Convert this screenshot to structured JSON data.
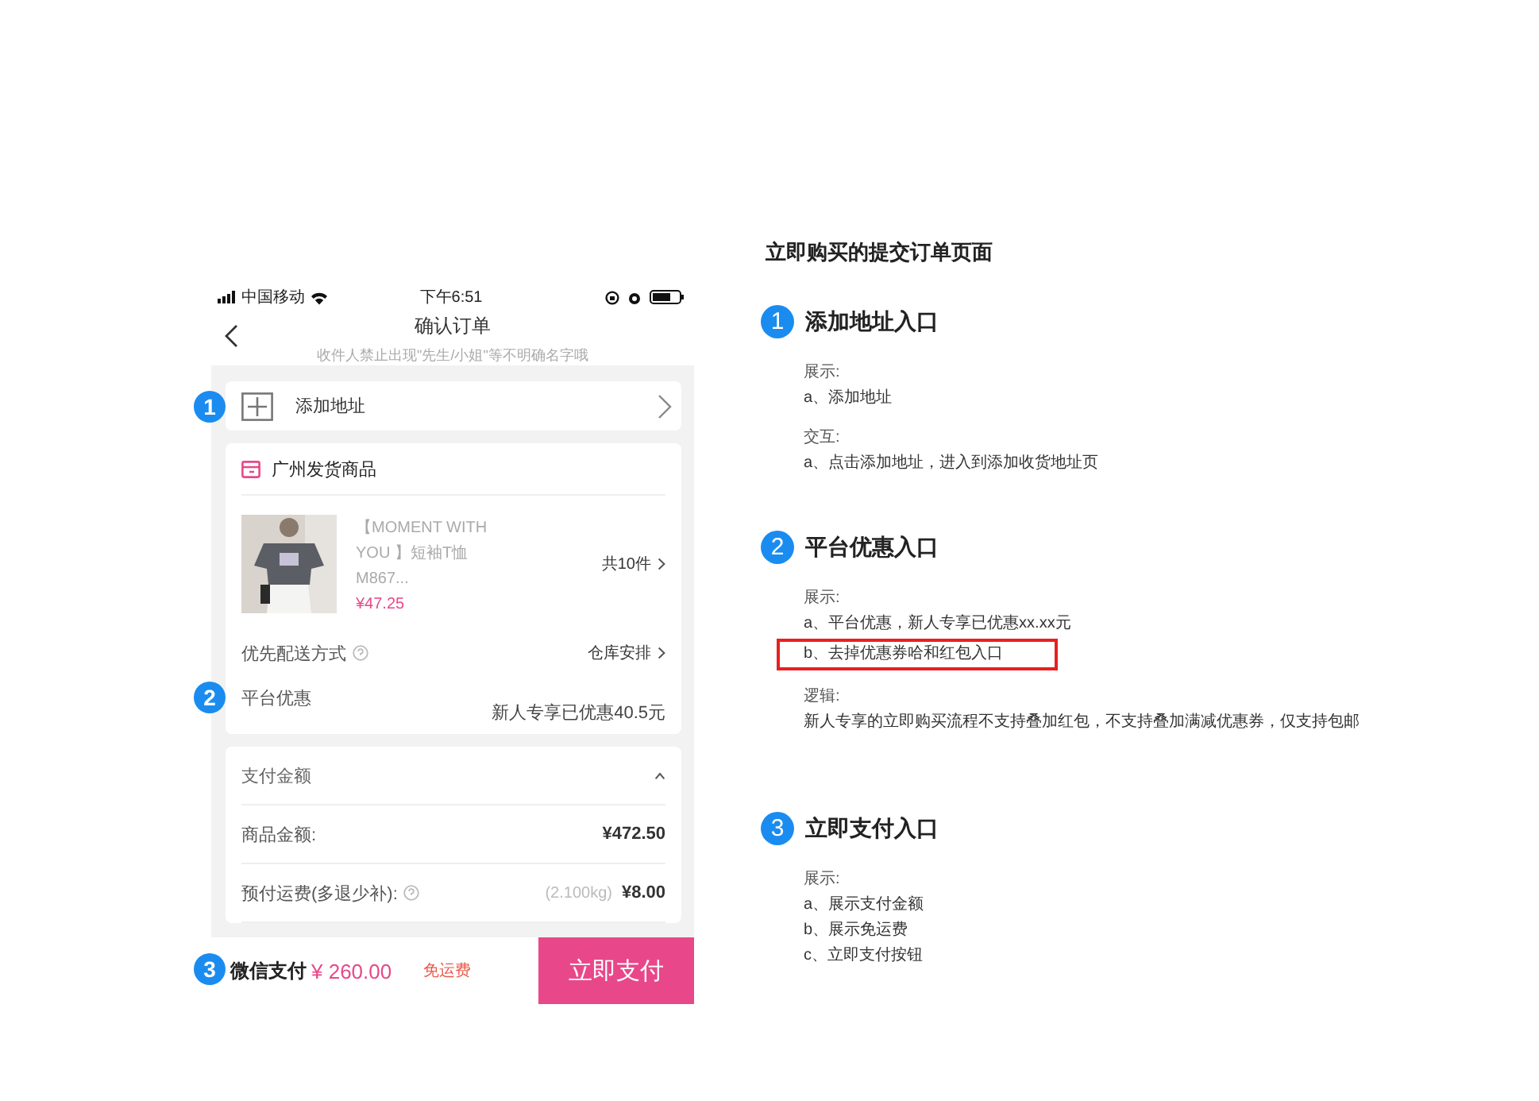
{
  "phone": {
    "status_bar": {
      "carrier": "中国移动",
      "time": "下午6:51"
    },
    "nav": {
      "title": "确认订单",
      "subtitle": "收件人禁止出现\"先生/小姐\"等不明确名字哦"
    },
    "address": {
      "marker": "1",
      "label": "添加地址"
    },
    "goods": {
      "store": "广州发货商品",
      "product": {
        "kind": "picture",
        "name": "【MOMENT WITH YOU 】短袖T恤  M867...",
        "price": "¥47.25",
        "count": "共10件"
      },
      "delivery": {
        "label": "优先配送方式",
        "value": "仓库安排"
      },
      "platform": {
        "marker": "2",
        "label": "平台优惠",
        "value": "新人专享已优惠40.5元"
      }
    },
    "payment": {
      "title": "支付金额",
      "expanded": true,
      "rows": [
        {
          "label": "商品金额:",
          "help": false,
          "value": "¥472.50"
        },
        {
          "label": "预付运费(多退少补):",
          "help": true,
          "note": "(2.100kg)",
          "value": "¥8.00"
        }
      ]
    },
    "bottom_bar": {
      "marker": "3",
      "method": "微信支付",
      "amount": "¥ 260.00",
      "shipping": "免运费",
      "button": "立即支付"
    }
  },
  "notes": {
    "title": "立即购买的提交订单页面",
    "sections": [
      {
        "number": "1",
        "title": "添加地址入口",
        "blocks": [
          {
            "heading": "展示:",
            "lines": [
              {
                "text": "a、添加地址",
                "highlighted": false
              }
            ]
          },
          {
            "heading": "交互:",
            "lines": [
              {
                "text": "a、点击添加地址，进入到添加收货地址页",
                "highlighted": false
              }
            ]
          }
        ]
      },
      {
        "number": "2",
        "title": "平台优惠入口",
        "blocks": [
          {
            "heading": "展示:",
            "lines": [
              {
                "text": "a、平台优惠，新人专享已优惠xx.xx元",
                "highlighted": false
              },
              {
                "text": "b、去掉优惠券哈和红包入口",
                "highlighted": true
              }
            ]
          },
          {
            "heading": "逻辑:",
            "lines": [
              {
                "text": "新人专享的立即购买流程不支持叠加红包，不支持叠加满减优惠券，仅支持包邮",
                "highlighted": false
              }
            ]
          }
        ]
      },
      {
        "number": "3",
        "title": "立即支付入口",
        "blocks": [
          {
            "heading": "展示:",
            "lines": [
              {
                "text": "a、展示支付金额",
                "highlighted": false
              },
              {
                "text": "b、展示免运费",
                "highlighted": false
              },
              {
                "text": "c、立即支付按钮",
                "highlighted": false
              }
            ]
          }
        ]
      }
    ]
  }
}
